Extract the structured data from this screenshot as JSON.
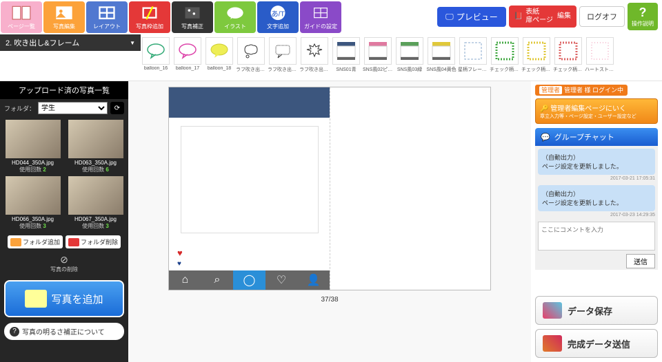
{
  "toolbar": {
    "items": [
      {
        "label": "ページ一覧"
      },
      {
        "label": "写真編集"
      },
      {
        "label": "レイアウト"
      },
      {
        "label": "写真枠追加"
      },
      {
        "label": "写真補正"
      },
      {
        "label": "イラスト"
      },
      {
        "label": "文字追加"
      },
      {
        "label": "ガイドの設定"
      }
    ],
    "preview": "プレビュー",
    "cover_l1": "表紙",
    "cover_l2": "扉ページ",
    "cover_edit": "編集",
    "logoff": "ログオフ",
    "help": "操作説明"
  },
  "category": {
    "selected": "2. 吹き出し&フレーム"
  },
  "assets": [
    {
      "label": "balloon_16"
    },
    {
      "label": "balloon_17"
    },
    {
      "label": "balloon_18"
    },
    {
      "label": "ラフ吹き出し‥"
    },
    {
      "label": "ラフ吹き出し‥"
    },
    {
      "label": "ラフ吹き出し‥"
    },
    {
      "label": "SNS01青"
    },
    {
      "label": "SNS風02ピン‥"
    },
    {
      "label": "SNS風03緑"
    },
    {
      "label": "SNS風04黄色"
    },
    {
      "label": "星柄フレーム‥"
    },
    {
      "label": "チェック柄フ‥"
    },
    {
      "label": "チェック柄フ‥"
    },
    {
      "label": "チェック柄フ‥"
    },
    {
      "label": "ハートストラ‥"
    }
  ],
  "sidebar": {
    "title": "アップロード済の写真一覧",
    "folder_label": "フォルダ：",
    "folder_value": "学生",
    "photos": [
      {
        "name": "HD044_350A.jpg",
        "uses_label": "使用回数",
        "count": "2"
      },
      {
        "name": "HD063_350A.jpg",
        "uses_label": "使用回数",
        "count": "6"
      },
      {
        "name": "HD066_350A.jpg",
        "uses_label": "使用回数",
        "count": "3"
      },
      {
        "name": "HD067_350A.jpg",
        "uses_label": "使用回数",
        "count": "3"
      }
    ],
    "folder_add": "フォルダ追加",
    "folder_del": "フォルダ削除",
    "trash": "写真の削除",
    "add_photo": "写真を追加",
    "brightness": "写真の明るさ補正について"
  },
  "canvas": {
    "page_num": "37/38"
  },
  "right": {
    "admin_status_prefix": "管理者",
    "admin_status": "管理者 様 ログイン中",
    "admin_link": "管理者編集ページにいく",
    "admin_sub": "章立入力等・ページ設定・ユーザー設定など",
    "chat_title": "グループチャット",
    "messages": [
      {
        "from": "（自動出力）",
        "body": "ページ設定を更新しました。",
        "ts": "2017-03-21 17:05:31"
      },
      {
        "from": "（自動出力）",
        "body": "ページ設定を更新しました。",
        "ts": "2017-03-23 14:29:35"
      }
    ],
    "placeholder": "ここにコメントを入力",
    "send": "送信",
    "save": "データ保存",
    "submit": "完成データ送信"
  }
}
